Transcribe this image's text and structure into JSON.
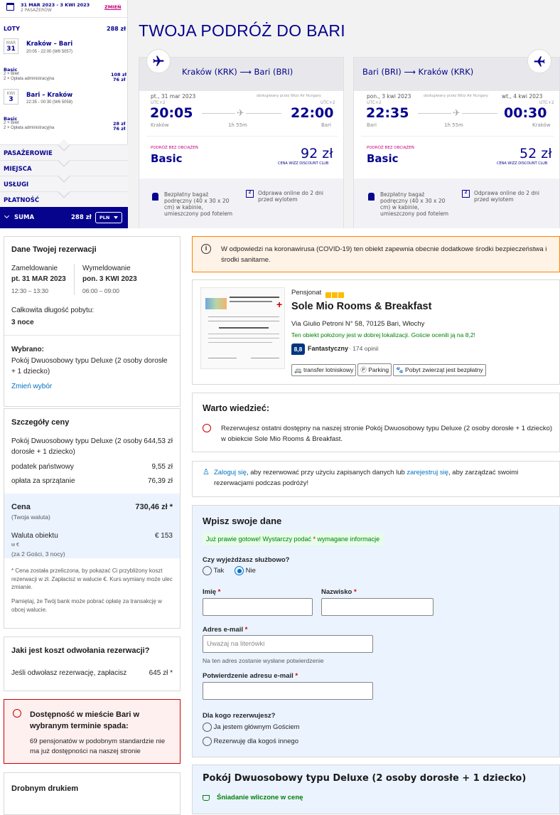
{
  "wizz": {
    "dates": "31 MAR 2023 - 3 KWI 2023",
    "passengers": "2 PASAŻERÓW",
    "change": "ZMIEŃ",
    "flights_label": "LOTY",
    "flights_total": "288 zł",
    "flight1": {
      "month": "MAR",
      "day": "31",
      "route": "Kraków – Bari",
      "time": "20:05 - 22:00 (W6 5057)",
      "fare": "Basic",
      "ticket": "2 × Bilet",
      "ticket_price": "108 zł",
      "fee": "2 × Opłata administracyjna",
      "fee_price": "76 zł"
    },
    "flight2": {
      "month": "KWI",
      "day": "3",
      "route": "Bari – Kraków",
      "time": "22:35 - 00:30 (W6 5058)",
      "fare": "Basic",
      "ticket": "2 × Bilet",
      "ticket_price": "28 zł",
      "fee": "2 × Opłata administracyjna",
      "fee_price": "76 zł"
    },
    "sections": [
      "PASAŻEROWIE",
      "MIEJSCA",
      "USŁUGI",
      "PŁATNOŚĆ"
    ],
    "sum_label": "SUMA",
    "sum_value": "288 zł",
    "currency": "PLN",
    "title": "TWOJA PODRÓŻ DO BARI",
    "card1": {
      "route": "Kraków (KRK) ⟶ Bari (BRI)",
      "date": "pt., 31 mar 2023",
      "operator": "obsługiwany przez Wizz Air Hungary",
      "utc_from": "UTC+2",
      "utc_to": "UTC+2",
      "dep": "20:05",
      "arr": "22:00",
      "duration": "1h 55m",
      "from": "Kraków",
      "to": "Bari",
      "bundle_label": "PODRÓŻ BEZ OBCIĄŻEŃ",
      "bundle": "Basic",
      "price": "92 zł",
      "club": "CENA WIZZ DISCOUNT CLUB",
      "perk1": "Bezpłatny bagaż podręczny (40 x 30 x 20 cm) w kabinie, umieszczony pod fotelem",
      "perk2": "Odprawa online do 2 dni przed wylotem"
    },
    "card2": {
      "route": "Bari (BRI) ⟶ Kraków (KRK)",
      "date": "pon., 3 kwi 2023",
      "date2": "wt., 4 kwi 2023",
      "operator": "obsługiwany przez Wizz Air Hungary",
      "utc_from": "UTC+2",
      "utc_to": "UTC+2",
      "dep": "22:35",
      "arr": "00:30",
      "duration": "1h 55m",
      "from": "Bari",
      "to": "Kraków",
      "bundle_label": "PODRÓŻ BEZ OBCIĄŻEŃ",
      "bundle": "Basic",
      "price": "52 zł",
      "club": "CENA WIZZ DISCOUNT CLUB",
      "perk1": "Bezpłatny bagaż podręczny (40 x 30 x 20 cm) w kabinie, umieszczony pod fotelem",
      "perk2": "Odprawa online do 2 dni przed wylotem"
    }
  },
  "booking": {
    "res_title": "Dane Twojej rezerwacji",
    "checkin_label": "Zameldowanie",
    "checkin_date": "pt. 31 MAR 2023",
    "checkin_time": "12:30 – 13:30",
    "checkout_label": "Wymeldowanie",
    "checkout_date": "pon. 3 KWI 2023",
    "checkout_time": "06:00 – 09:00",
    "length_label": "Całkowita długość pobytu:",
    "length": "3 noce",
    "selected_label": "Wybrano:",
    "selected": "Pokój Dwuosobowy typu Deluxe (2 osoby dorosłe + 1 dziecko)",
    "change": "Zmień wybór",
    "price_title": "Szczegóły ceny",
    "room_label": "Pokój Dwuosobowy typu Deluxe (2 osoby dorosłe + 1 dziecko)",
    "room_price": "644,53 zł",
    "tax_label": "podatek państwowy",
    "tax": "9,55 zł",
    "clean_label": "opłata za sprzątanie",
    "clean": "76,39 zł",
    "total_label": "Cena",
    "total_sub": "(Twoja waluta)",
    "total": "730,46 zł *",
    "hotel_cur_label": "Waluta obiektu",
    "hotel_cur_sub": "w €",
    "hotel_cur_guests": "(za 2 Gości, 3 nocy)",
    "hotel_cur": "€ 153",
    "note1": "* Cena została przeliczona, by pokazać Ci przybliżony koszt rezerwacji w zł. Zapłacisz w walucie €. Kurs wymiany może ulec zmianie.",
    "note2": "Pamiętaj, że Twój bank może pobrać opłatę za transakcję w obcej walucie.",
    "cancel_title": "Jaki jest koszt odwołania rezerwacji?",
    "cancel_text": "Jeśli odwołasz rezerwację, zapłacisz",
    "cancel_price": "645 zł *",
    "avail_title": "Dostępność w mieście Bari w wybranym terminie spada:",
    "avail_text": "69 pensjonatów w podobnym standardzie nie ma już dostępności na naszej stronie",
    "fine_print": "Drobnym drukiem",
    "covid": "W odpowiedzi na koronawirusa (COVID-19) ten obiekt zapewnia obecnie dodatkowe środki bezpieczeństwa i środki sanitarne.",
    "hotel_type": "Pensjonat",
    "hotel_name": "Sole Mio Rooms & Breakfast",
    "address": "Via Giulio Petroni N° 58, 70125 Bari, Włochy",
    "location_note": "Ten obiekt położony jest w dobrej lokalizacji. Goście ocenili ją na 8,2!",
    "score": "8,8",
    "score_word": "Fantastyczny",
    "reviews": "· 174 opinii",
    "amenities": [
      "transfer lotniskowy",
      "Parking",
      "Pobyt zwierząt jest bezpłatny"
    ],
    "worth_title": "Warto wiedzieć:",
    "worth_text": "Rezerwujesz ostatni dostępny na naszej stronie Pokój Dwuosobowy typu Deluxe (2 osoby dorosłe + 1 dziecko) w obiekcie Sole Mio Rooms & Breakfast.",
    "login_link": "Zaloguj się",
    "login_mid": ", aby rezerwować przy użyciu zapisanych danych lub ",
    "register_link": "zarejestruj się",
    "login_end": ", aby zarządzać swoimi rezerwacjami podczas podróży!",
    "form_title": "Wpisz swoje dane",
    "form_notice_a": "Już prawie gotowe! Wystarczy podać",
    "form_notice_b": "wymagane informacje",
    "business_q": "Czy wyjeżdżasz służbowo?",
    "yes": "Tak",
    "no": "Nie",
    "first_name": "Imię",
    "last_name": "Nazwisko",
    "email_label": "Adres e-mail",
    "email_placeholder": "Uważaj na literówki",
    "email_hint": "Na ten adres zostanie wysłane potwierdzenie",
    "email_confirm": "Potwierdzenie adresu e-mail",
    "for_whom": "Dla kogo rezerwujesz?",
    "opt1": "Ja jestem głównym Gościem",
    "opt2": "Rezerwuję dla kogoś innego",
    "room_title": "Pokój Dwuosobowy typu Deluxe (2 osoby dorosłe + 1 dziecko)",
    "breakfast": "Śniadanie wliczone w cenę",
    "asterisk": "*"
  }
}
